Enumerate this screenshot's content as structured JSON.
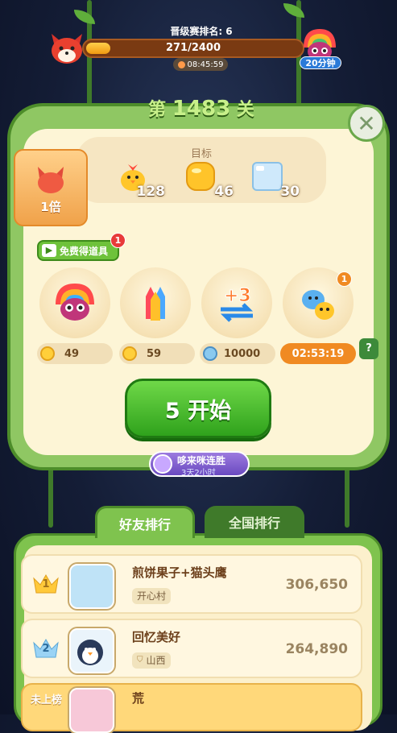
{
  "top_bar": {
    "rank_title": "晋级赛排名: 6",
    "progress_text": "271/2400",
    "progress_fraction": 0.113,
    "timer": "08:45:59",
    "owl_label": "20分钟"
  },
  "level": {
    "prefix": "第",
    "number": "1483",
    "suffix": "关"
  },
  "goal": {
    "title": "目标",
    "items": [
      {
        "icon": "chick-icon",
        "count": "128"
      },
      {
        "icon": "yellow-cube-icon",
        "count": "46"
      },
      {
        "icon": "ice-block-icon",
        "count": "30"
      }
    ]
  },
  "multiplier": {
    "label": "1倍"
  },
  "free_items": {
    "label": "免费得道具",
    "badge": "1"
  },
  "boosters": [
    {
      "icon": "rainbow-owl-icon",
      "price": "49",
      "currency": "coin"
    },
    {
      "icon": "rocket-icon",
      "price": "59",
      "currency": "coin"
    },
    {
      "icon": "plus-three-moves-icon",
      "price": "10000",
      "currency": "silver-coin"
    },
    {
      "icon": "pet-pair-icon",
      "price": "02:53:19",
      "currency": "timer",
      "badge": "1"
    }
  ],
  "help_label": "?",
  "start_button": {
    "label": "5 开始"
  },
  "streak": {
    "title": "哆来咪连胜",
    "subtitle": "3天2小时"
  },
  "tabs": [
    {
      "label": "好友排行",
      "active": true
    },
    {
      "label": "全国排行",
      "active": false
    }
  ],
  "leaderboard": [
    {
      "rank": "1",
      "name": "煎饼果子+猫头鹰",
      "location": "开心村",
      "score": "306,650"
    },
    {
      "rank": "2",
      "name": "回忆美好",
      "location": "山西",
      "score": "264,890"
    },
    {
      "rank_label": "未上榜",
      "name": "荒"
    }
  ],
  "colors": {
    "accent_green": "#6ec23b",
    "panel_cream": "#fdf5d6",
    "timer_orange": "#f08a22"
  }
}
